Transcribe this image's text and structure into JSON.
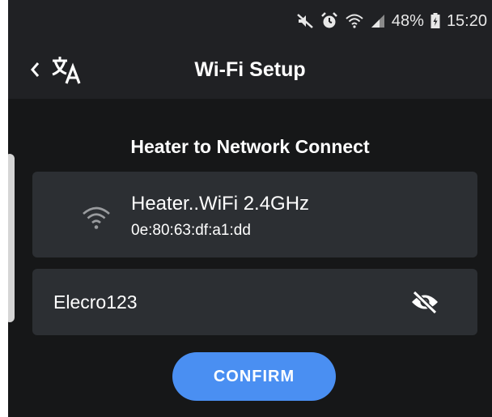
{
  "status_bar": {
    "battery": "48%",
    "time": "15:20",
    "icons": [
      "mute-icon",
      "alarm-icon",
      "wifi-status-icon",
      "signal-icon",
      "battery-icon"
    ]
  },
  "app_bar": {
    "title": "Wi-Fi Setup",
    "back_icon": "chevron-left-icon",
    "translate_icon": "translate-icon"
  },
  "main": {
    "section_title": "Heater to Network Connect",
    "network": {
      "ssid": "Heater..WiFi 2.4GHz",
      "mac": "0e:80:63:df:a1:dd",
      "icon": "wifi-icon"
    },
    "password": {
      "value": "Elecro123",
      "visibility_icon": "eye-off-icon"
    },
    "confirm_label": "CONFIRM"
  },
  "colors": {
    "background": "#161718",
    "appbar": "#202124",
    "card": "#2c2f33",
    "accent": "#4a8ff2",
    "text": "#ffffff"
  }
}
